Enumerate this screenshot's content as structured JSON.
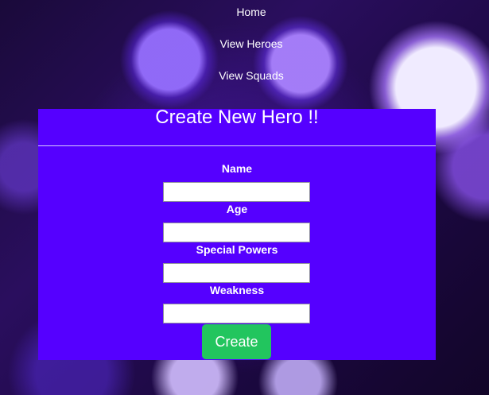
{
  "nav": {
    "home": "Home",
    "view_heroes": "View Heroes",
    "view_squads": "View Squads"
  },
  "form": {
    "title": "Create New Hero !!",
    "fields": [
      {
        "label": "Name",
        "value": "",
        "placeholder": ""
      },
      {
        "label": "Age",
        "value": "",
        "placeholder": ""
      },
      {
        "label": "Special Powers",
        "value": "",
        "placeholder": ""
      },
      {
        "label": "Weakness",
        "value": "",
        "placeholder": ""
      }
    ],
    "submit_label": "Create"
  },
  "colors": {
    "card_background": "#5500ff",
    "button_background": "#22c55e",
    "text": "#ffffff"
  }
}
